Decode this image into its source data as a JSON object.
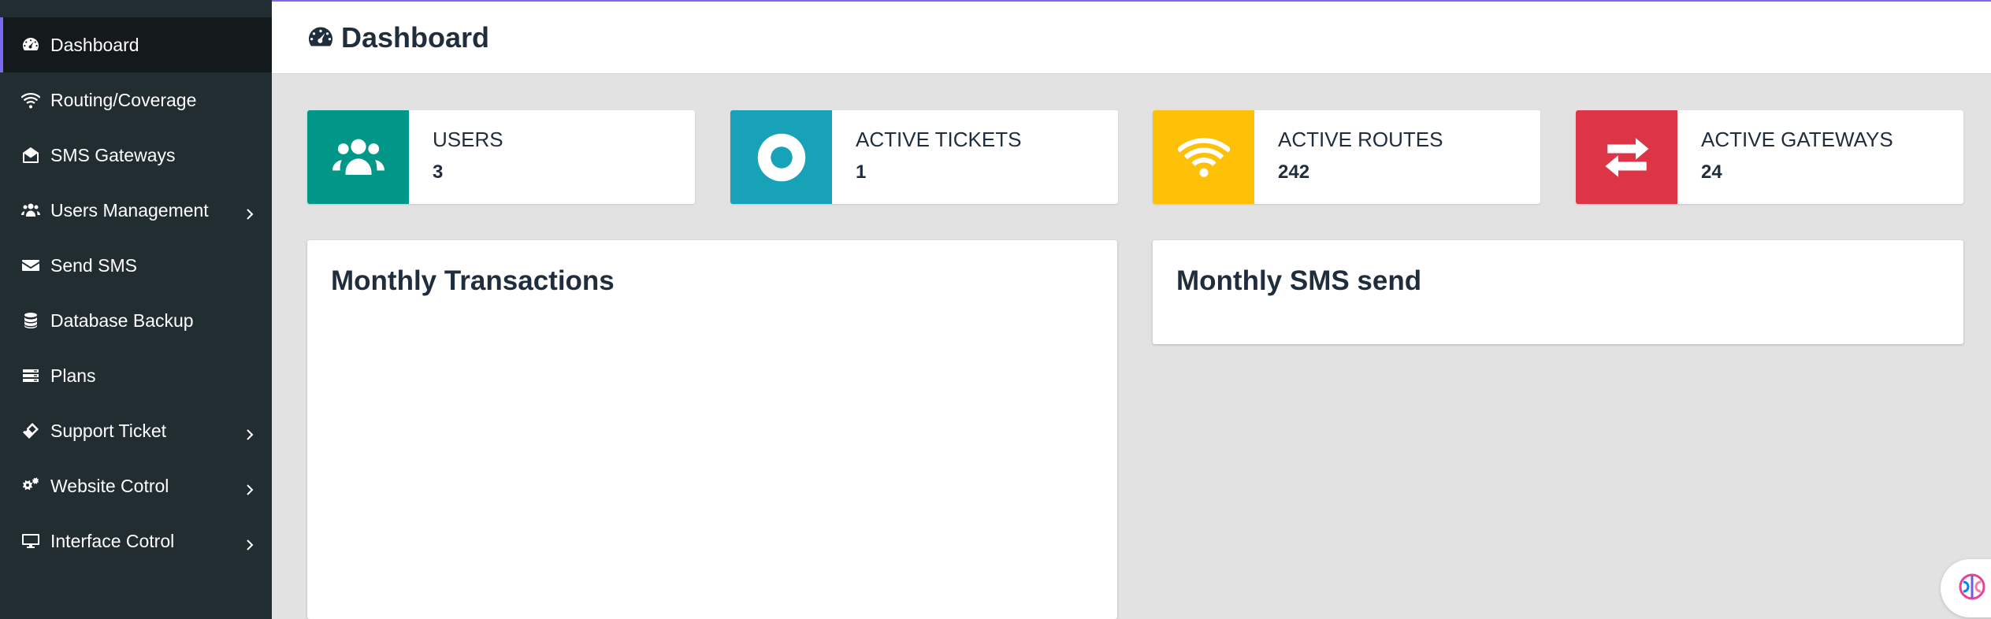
{
  "sidebar": {
    "items": [
      {
        "label": "Dashboard",
        "icon": "tachometer-icon",
        "active": true,
        "has_submenu": false
      },
      {
        "label": "Routing/Coverage",
        "icon": "wifi-icon",
        "active": false,
        "has_submenu": false
      },
      {
        "label": "SMS Gateways",
        "icon": "envelope-open-icon",
        "active": false,
        "has_submenu": false
      },
      {
        "label": "Users Management",
        "icon": "users-icon",
        "active": false,
        "has_submenu": true
      },
      {
        "label": "Send SMS",
        "icon": "envelope-icon",
        "active": false,
        "has_submenu": false
      },
      {
        "label": "Database Backup",
        "icon": "database-icon",
        "active": false,
        "has_submenu": false
      },
      {
        "label": "Plans",
        "icon": "server-icon",
        "active": false,
        "has_submenu": false
      },
      {
        "label": "Support Ticket",
        "icon": "ticket-icon",
        "active": false,
        "has_submenu": true
      },
      {
        "label": "Website Cotrol",
        "icon": "cogs-icon",
        "active": false,
        "has_submenu": true
      },
      {
        "label": "Interface Cotrol",
        "icon": "desktop-icon",
        "active": false,
        "has_submenu": true
      }
    ]
  },
  "header": {
    "title": "Dashboard",
    "icon": "tachometer-icon"
  },
  "info_boxes": [
    {
      "label": "USERS",
      "value": "3",
      "color": "#009688",
      "icon": "users-icon"
    },
    {
      "label": "ACTIVE TICKETS",
      "value": "1",
      "color": "#17a2b8",
      "icon": "life-ring-icon"
    },
    {
      "label": "ACTIVE ROUTES",
      "value": "242",
      "color": "#ffc107",
      "icon": "wifi-icon"
    },
    {
      "label": "ACTIVE GATEWAYS",
      "value": "24",
      "color": "#dc3545",
      "icon": "exchange-icon"
    }
  ],
  "cards": {
    "monthly_transactions": {
      "title": "Monthly Transactions"
    },
    "monthly_sms": {
      "title": "Monthly SMS send"
    }
  },
  "colors": {
    "sidebar_bg": "#222d32",
    "active_accent": "#7b68ee",
    "content_bg": "#e2e2e2"
  }
}
